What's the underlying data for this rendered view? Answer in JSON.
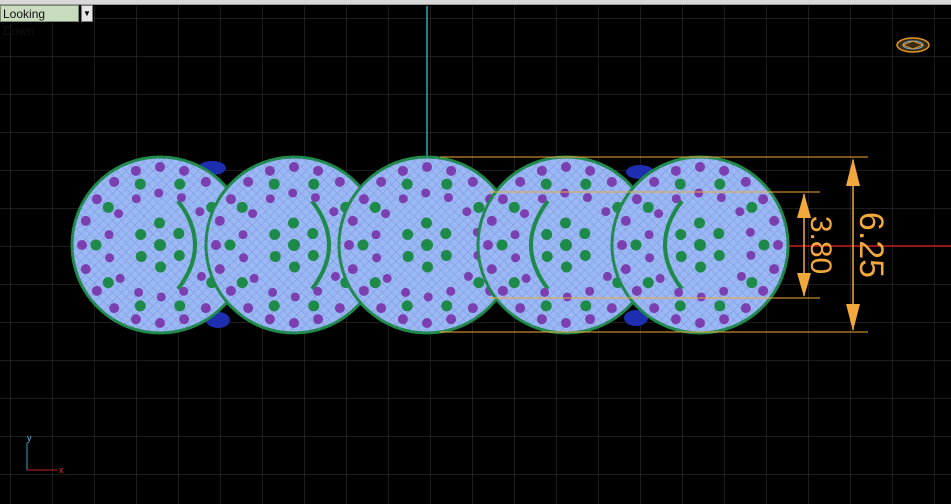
{
  "viewport": {
    "view_name": "Looking Down",
    "dropdown_icon": "chevron-down-icon"
  },
  "dimensions": {
    "inner": "3.80",
    "outer": "6.25"
  },
  "axes": {
    "y_label": "y",
    "x_label": "x"
  },
  "colors": {
    "background": "#000000",
    "grid": "#3a3a3a",
    "dimension": "#f2a83a",
    "gem_fill": "#9ab8f5",
    "metal_green": "#1e8a4a",
    "prong_purple": "#7b3fb0",
    "axis_red": "#c81f1f",
    "axis_cyan": "#2aa7b7"
  },
  "navigation_widget_icon": "compass-icon"
}
